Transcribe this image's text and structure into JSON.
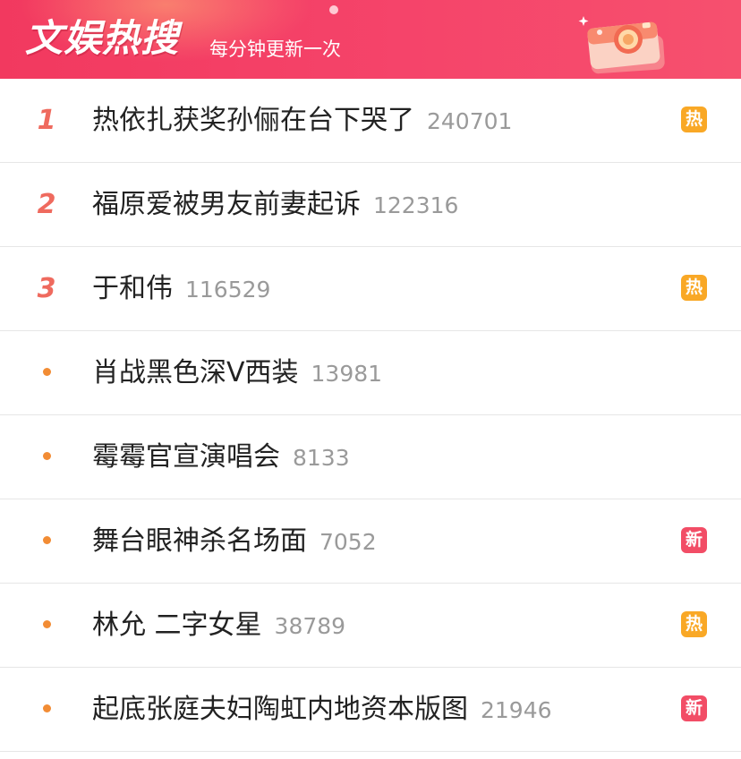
{
  "header": {
    "title": "文娱热搜",
    "subtitle": "每分钟更新一次",
    "icon": "camera-icon"
  },
  "colors": {
    "header_gradient_start": "#f2395f",
    "header_gradient_end": "#f6506e",
    "rank_color": "#ef6a5e",
    "bullet_color": "#f28c34",
    "hot_badge": "#f9a826",
    "new_badge": "#f24d66"
  },
  "items": [
    {
      "rank": "1",
      "title": "热依扎获奖孙俪在台下哭了",
      "count": "240701",
      "badge": "热",
      "badge_type": "hot"
    },
    {
      "rank": "2",
      "title": "福原爱被男友前妻起诉",
      "count": "122316",
      "badge": "",
      "badge_type": ""
    },
    {
      "rank": "3",
      "title": "于和伟",
      "count": "116529",
      "badge": "热",
      "badge_type": "hot"
    },
    {
      "rank": "",
      "title": "肖战黑色深V西装",
      "count": "13981",
      "badge": "",
      "badge_type": ""
    },
    {
      "rank": "",
      "title": "霉霉官宣演唱会",
      "count": "8133",
      "badge": "",
      "badge_type": ""
    },
    {
      "rank": "",
      "title": "舞台眼神杀名场面",
      "count": "7052",
      "badge": "新",
      "badge_type": "new"
    },
    {
      "rank": "",
      "title": "林允 二字女星",
      "count": "38789",
      "badge": "热",
      "badge_type": "hot"
    },
    {
      "rank": "",
      "title": "起底张庭夫妇陶虹内地资本版图",
      "count": "21946",
      "badge": "新",
      "badge_type": "new"
    }
  ]
}
